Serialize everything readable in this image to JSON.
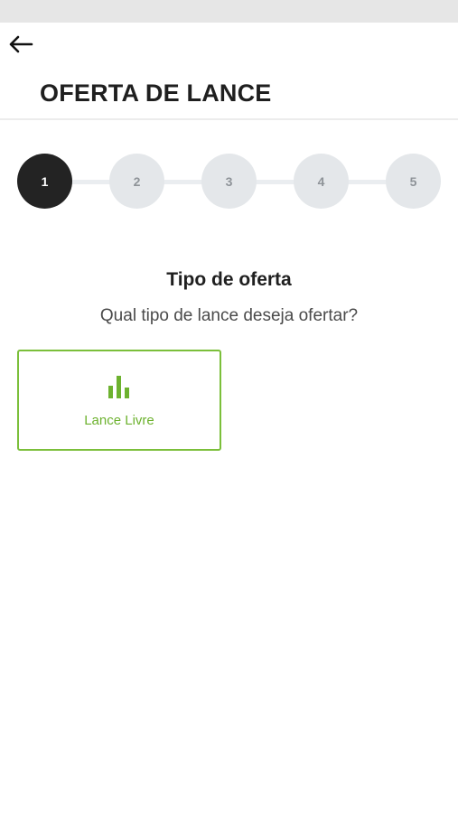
{
  "header": {
    "back_icon": "arrow-left-icon",
    "title": "OFERTA DE LANCE"
  },
  "stepper": {
    "current_step": 1,
    "steps": [
      "1",
      "2",
      "3",
      "4",
      "5"
    ]
  },
  "section": {
    "title": "Tipo de oferta",
    "subtitle": "Qual tipo de lance deseja ofertar?"
  },
  "options": [
    {
      "label": "Lance Livre",
      "icon": "bar-chart-icon",
      "selected": true
    }
  ],
  "colors": {
    "accent": "#7bbf3a",
    "active_step": "#232323",
    "inactive_step": "#e4e7ea"
  }
}
